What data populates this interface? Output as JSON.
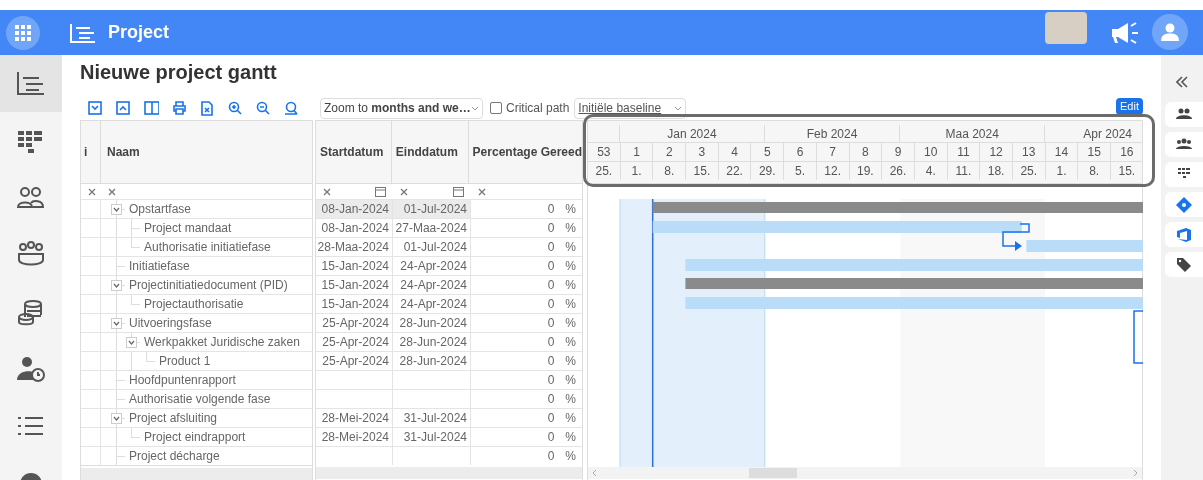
{
  "app_bar": {
    "title": "Project"
  },
  "left_nav": [
    {
      "selected": true
    },
    {
      "selected": false
    },
    {
      "selected": false
    },
    {
      "selected": false
    },
    {
      "selected": false
    },
    {
      "selected": false
    },
    {
      "selected": false
    },
    {
      "selected": false
    }
  ],
  "page_title": "Nieuwe project gantt",
  "toolbar": {
    "zoom": "Zoom to **months and we…**",
    "critical_path": {
      "label": "Critical path",
      "checked": false
    },
    "baseline": "Initiële baseline",
    "edit": "Edit"
  },
  "columns": [
    {
      "label": "i"
    },
    {
      "label": "Naam"
    },
    {
      "label": "Startdatum"
    },
    {
      "label": "Einddatum"
    },
    {
      "label": "Percentage Gereed"
    }
  ],
  "tasks": [
    {
      "name": "Opstartfase",
      "start": "08-Jan-2024",
      "end": "01-Jul-2024",
      "percent": "0",
      "unit": "%",
      "selected": true,
      "expanded": true,
      "children": [
        {
          "name": "Project mandaat",
          "start": "08-Jan-2024",
          "end": "27-Maa-2024",
          "percent": "0",
          "unit": "%",
          "selected": false
        },
        {
          "name": "Authorisatie initiatiefase",
          "start": "28-Maa-2024",
          "end": "01-Jul-2024",
          "percent": "0",
          "unit": "%",
          "selected": false
        }
      ]
    },
    {
      "name": "Initiatiefase",
      "start": "15-Jan-2024",
      "end": "24-Apr-2024",
      "percent": "0",
      "unit": "%",
      "selected": false
    },
    {
      "name": "Projectinitiatiedocument (PID)",
      "start": "15-Jan-2024",
      "end": "24-Apr-2024",
      "percent": "0",
      "unit": "%",
      "selected": false,
      "expanded": true,
      "children": [
        {
          "name": "Projectauthorisatie",
          "start": "15-Jan-2024",
          "end": "24-Apr-2024",
          "percent": "0",
          "unit": "%",
          "selected": false
        }
      ]
    },
    {
      "name": "Uitvoeringsfase",
      "start": "25-Apr-2024",
      "end": "28-Jun-2024",
      "percent": "0",
      "unit": "%",
      "selected": false,
      "expanded": true,
      "children": [
        {
          "name": "Werkpakket Juridische zaken",
          "start": "25-Apr-2024",
          "end": "28-Jun-2024",
          "percent": "0",
          "unit": "%",
          "selected": false,
          "expanded": true,
          "children": [
            {
              "name": "Product 1",
              "start": "25-Apr-2024",
              "end": "28-Jun-2024",
              "percent": "0",
              "unit": "%",
              "selected": false
            }
          ]
        }
      ]
    },
    {
      "name": "Hoofdpuntenrapport",
      "percent": "0",
      "unit": "%",
      "selected": false
    },
    {
      "name": "Authorisatie volgende fase",
      "percent": "0",
      "unit": "%",
      "selected": false
    },
    {
      "name": "Project afsluiting",
      "start": "28-Mei-2024",
      "end": "31-Jul-2024",
      "percent": "0",
      "unit": "%",
      "selected": false,
      "expanded": true,
      "children": [
        {
          "name": "Project eindrapport",
          "start": "28-Mei-2024",
          "end": "31-Jul-2024",
          "percent": "0",
          "unit": "%",
          "selected": false
        }
      ]
    },
    {
      "name": "Project décharge",
      "percent": "0",
      "unit": "%",
      "selected": false
    }
  ],
  "timeline": {
    "months": [
      "Jan 2024",
      "Feb 2024",
      "Maa 2024",
      "Apr 2024"
    ],
    "weeks": [
      "53",
      "1",
      "2",
      "3",
      "4",
      "5",
      "6",
      "7",
      "8",
      "9",
      "10",
      "11",
      "12",
      "13",
      "14",
      "15",
      "16"
    ],
    "days": [
      "25.",
      "1.",
      "8.",
      "15.",
      "22.",
      "29.",
      "5.",
      "12.",
      "19.",
      "26.",
      "4.",
      "11.",
      "18.",
      "25.",
      "1.",
      "8.",
      "15."
    ]
  }
}
